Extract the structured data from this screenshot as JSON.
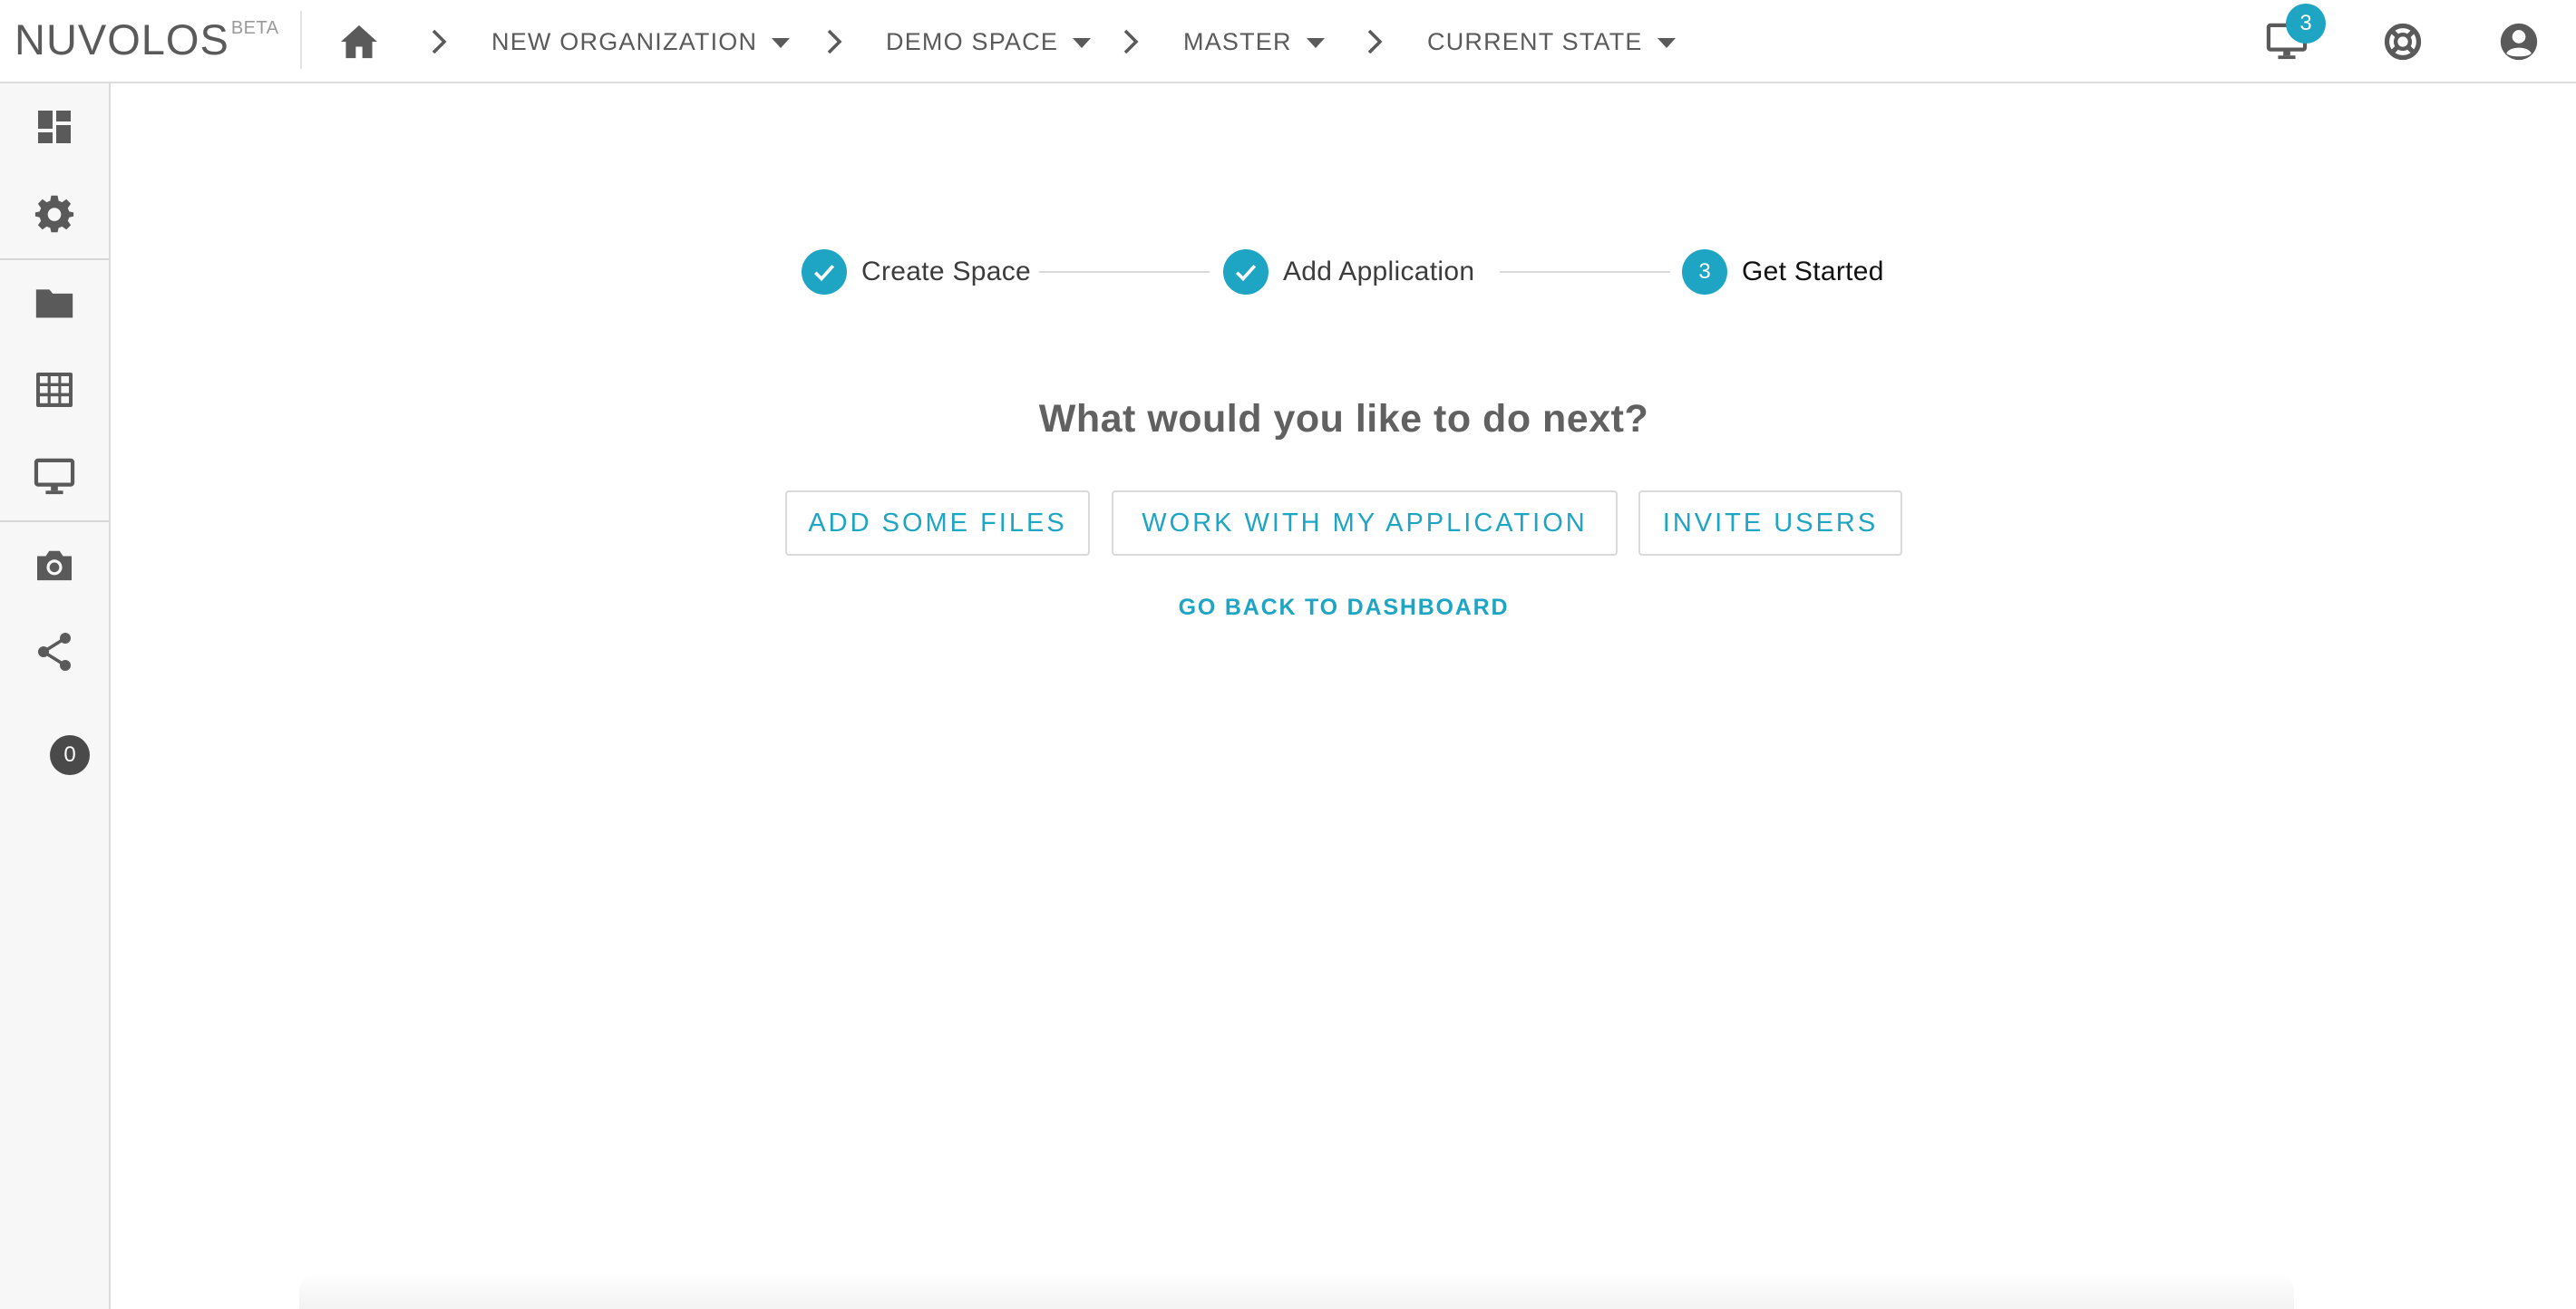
{
  "app": {
    "logo": "NUVOLOS",
    "logo_badge": "BETA"
  },
  "breadcrumb": {
    "items": [
      {
        "label": "NEW ORGANIZATION"
      },
      {
        "label": "DEMO SPACE"
      },
      {
        "label": "MASTER"
      },
      {
        "label": "CURRENT STATE"
      }
    ]
  },
  "topbar": {
    "icons": [
      "home-icon",
      "desktop-icon",
      "lifebuoy-icon",
      "account-icon"
    ],
    "notification_count": "3"
  },
  "sidebar": {
    "items": [
      {
        "icon": "dashboard-icon"
      },
      {
        "icon": "gear-icon"
      },
      {
        "icon": "folder-icon"
      },
      {
        "icon": "table-icon"
      },
      {
        "icon": "desktop-icon"
      },
      {
        "icon": "camera-icon"
      },
      {
        "icon": "share-icon"
      }
    ],
    "share_count": "0"
  },
  "stepper": {
    "steps": [
      {
        "label": "Create Space",
        "state": "complete"
      },
      {
        "label": "Add Application",
        "state": "complete"
      },
      {
        "label": "Get Started",
        "state": "active",
        "number": "3"
      }
    ]
  },
  "main": {
    "question": "What would you like to do next?",
    "actions": [
      {
        "label": "ADD SOME FILES"
      },
      {
        "label": "WORK WITH MY APPLICATION"
      },
      {
        "label": "INVITE USERS"
      }
    ],
    "back_link": "GO BACK TO DASHBOARD"
  },
  "colors": {
    "accent": "#1ea5c4",
    "text": "#5a5a5a",
    "sidebar_bg": "#f7f7f7"
  }
}
